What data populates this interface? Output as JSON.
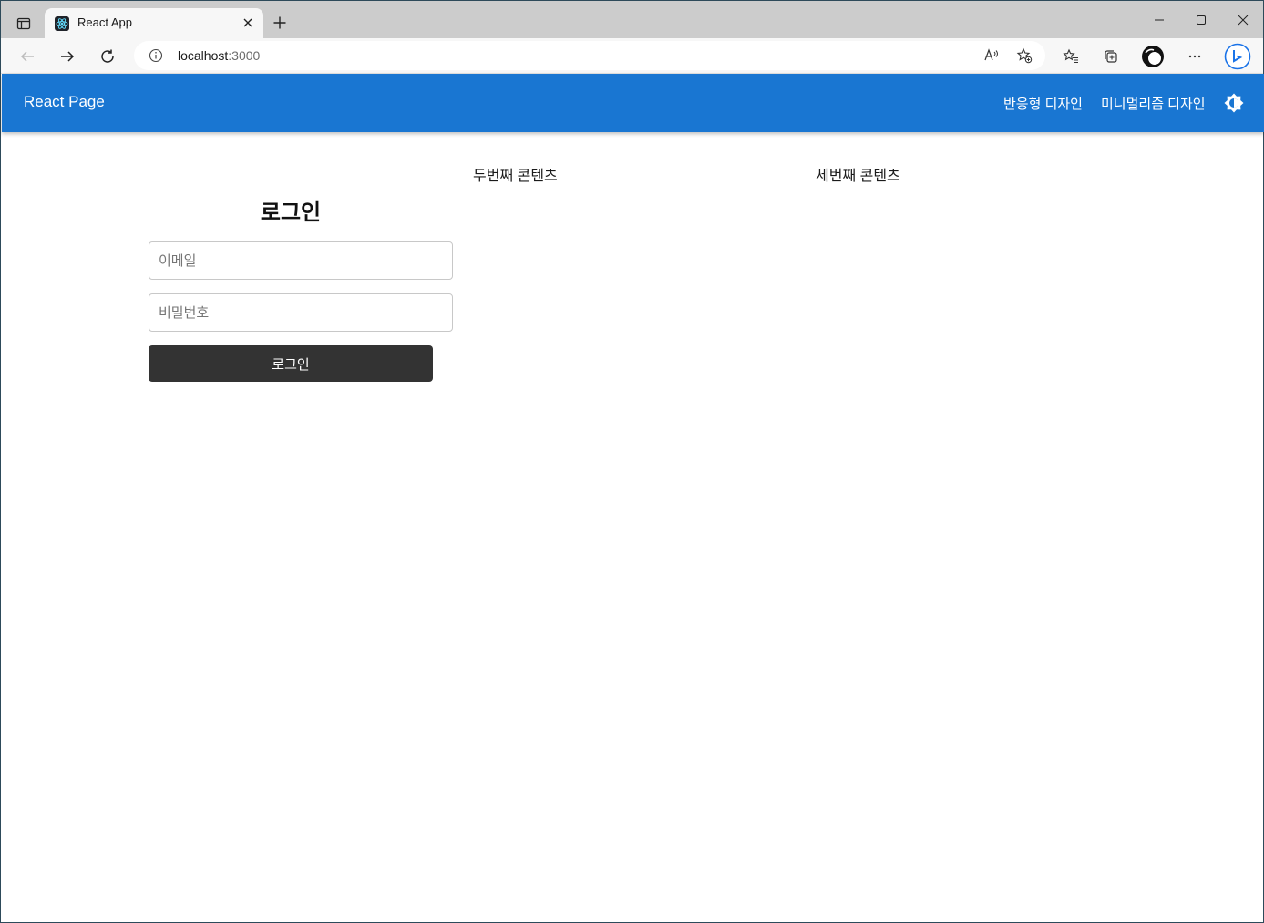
{
  "browser": {
    "tab_title": "React App",
    "address_host": "localhost",
    "address_port": ":3000"
  },
  "appbar": {
    "brand": "React Page",
    "nav": [
      "반응형 디자인",
      "미니멀리즘 디자인"
    ],
    "theme_icon": "brightness-icon",
    "color": "#1976d2"
  },
  "main": {
    "second_content": "두번째 콘텐츠",
    "third_content": "세번째 콘텐츠",
    "login": {
      "title": "로그인",
      "email_placeholder": "이메일",
      "password_placeholder": "비밀번호",
      "button_label": "로그인",
      "button_color": "#333333"
    }
  }
}
